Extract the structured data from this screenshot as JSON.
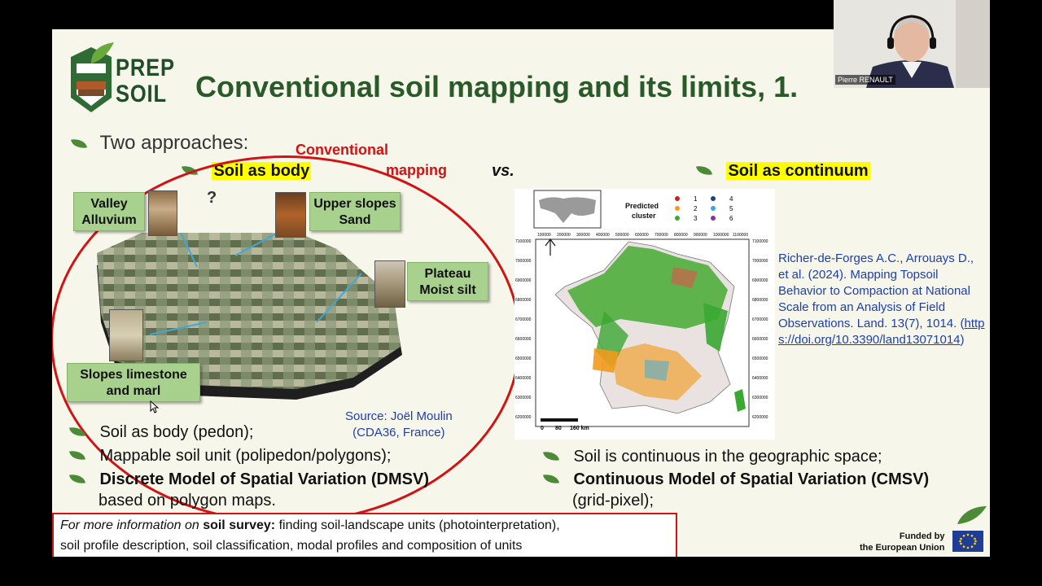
{
  "slide": {
    "logo_text": "PREP\nSOIL",
    "logo_line1": "PREP",
    "logo_line2": "SOIL",
    "title": "Conventional soil mapping and its limits, 1.",
    "intro": "Two approaches:",
    "conventional_label_1": "Conventional",
    "conventional_label_2": "mapping",
    "left_heading": "Soil as body",
    "vs": "vs.",
    "right_heading": "Soil as continuum",
    "labels": {
      "valley": "Valley Alluvium",
      "upper": "Upper slopes Sand",
      "plateau": "Plateau Moist silt",
      "slopes": "Slopes limestone and marl"
    },
    "question_marks": "?",
    "source_line1": "Source: Joël Moulin",
    "source_line2": "(CDA36, France)",
    "left_bullets": [
      "Soil as body (pedon);",
      "Mappable soil unit (polipedon/polygons);",
      "Discrete Model of Spatial Variation (DMSV)",
      "based on polygon maps."
    ],
    "right_bullets": [
      "Soil is continuous in the geographic space;",
      "Continuous Model of Spatial Variation (CMSV)",
      "(grid-pixel);"
    ],
    "map": {
      "legend_title": "Predicted cluster",
      "legend_items": [
        "1",
        "2",
        "3",
        "4",
        "5",
        "6"
      ],
      "legend_colors": [
        "#c0281f",
        "#f29a1d",
        "#3aa832",
        "#1c3f8f",
        "#33a9e0",
        "#8e2f9d"
      ],
      "scale_labels": [
        "0",
        "80",
        "160 km"
      ],
      "y_ticks_left": [
        "7100000",
        "7000000",
        "6900000",
        "6800000",
        "6700000",
        "6600000",
        "6500000",
        "6400000",
        "6300000",
        "6200000"
      ],
      "x_ticks_top": [
        "100000",
        "200000",
        "300000",
        "400000",
        "500000",
        "600000",
        "700000",
        "800000",
        "900000",
        "1000000",
        "1100000"
      ]
    },
    "reference": {
      "text": "Richer-de-Forges A.C., Arrouays D., et al. (2024). Mapping Topsoil Behavior to Compaction at National Scale from an Analysis of Field Observations. Land. 13(7), 1014.",
      "link_open": "(",
      "link": "https://doi.org/10.3390/land13071014",
      "link_close": ")"
    },
    "info_box": {
      "prefix_italic": "For more information on ",
      "bold": "soil survey:",
      "rest_line1": " finding soil-landscape units (photointerpretation),",
      "line2": "soil profile description, soil classification, modal profiles and composition of units"
    },
    "funded": {
      "line1": "Funded by",
      "line2": "the European Union"
    }
  },
  "webcam": {
    "name": "Pierre RENAULT"
  },
  "colors": {
    "title_green": "#2b5a2a",
    "accent_red": "#d11313",
    "highlight": "#ffff00",
    "label_green": "#a9d18e",
    "link_blue": "#1f3fa8"
  }
}
